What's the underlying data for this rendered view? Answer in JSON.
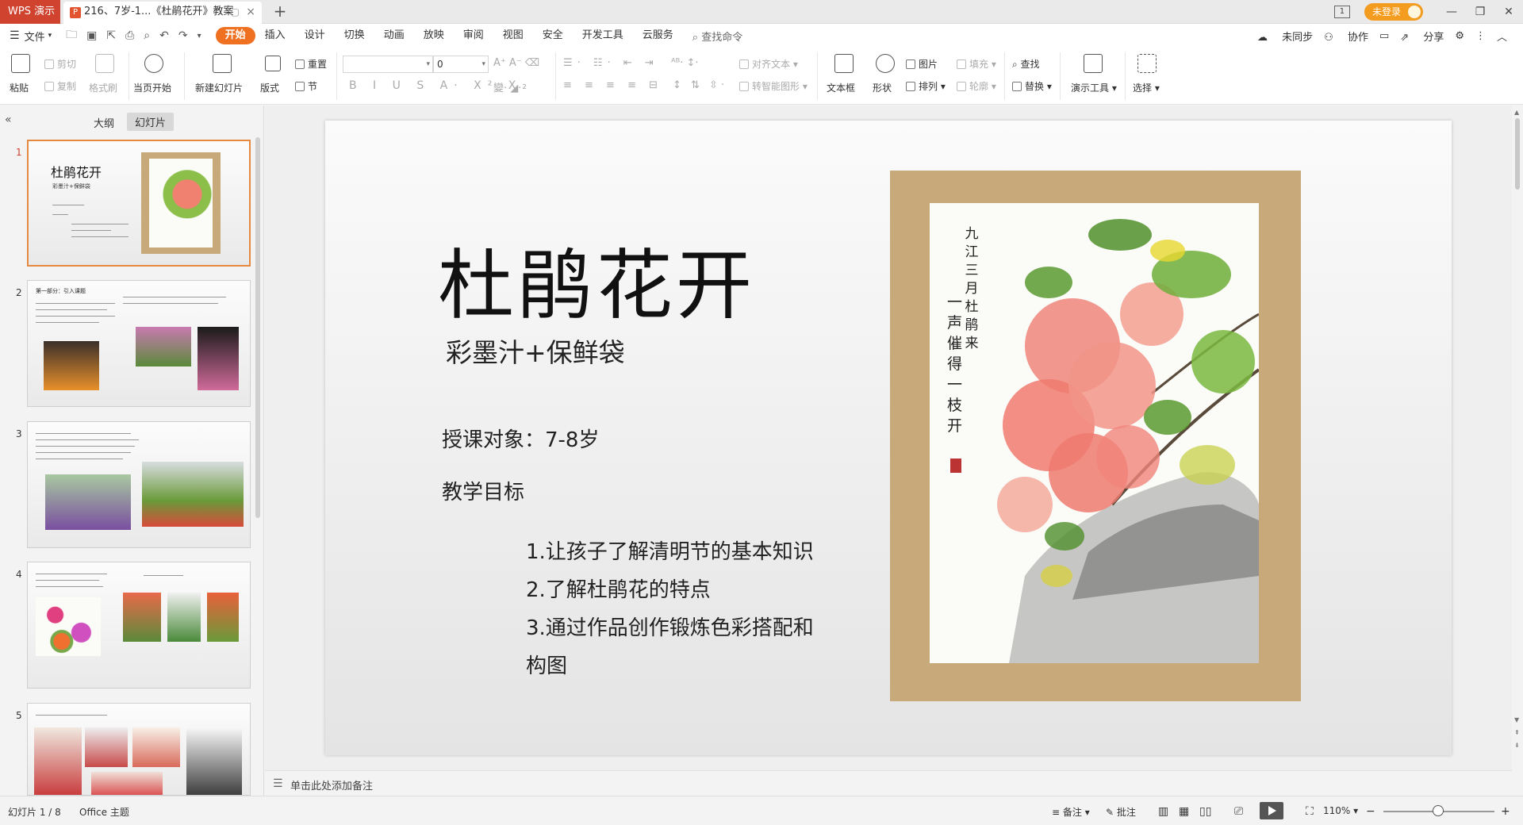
{
  "titlebar": {
    "app_tab": "WPS 演示",
    "doc_tab": "216、7岁-1...《杜鹃花开》教案",
    "login": "未登录"
  },
  "menubar": {
    "file": "文件",
    "tabs": [
      "开始",
      "插入",
      "设计",
      "切换",
      "动画",
      "放映",
      "审阅",
      "视图",
      "安全",
      "开发工具",
      "云服务"
    ],
    "search_cmd": "查找命令",
    "right": {
      "sync": "未同步",
      "collab": "协作",
      "share": "分享"
    }
  },
  "ribbon": {
    "paste": "粘贴",
    "cut": "剪切",
    "copy": "复制",
    "format_painter": "格式刷",
    "start_from_current": "当页开始",
    "new_slide": "新建幻灯片",
    "layout": "版式",
    "reset": "重置",
    "section": "节",
    "font_size_value": "0",
    "align_text": "对齐文本",
    "convert_smartart": "转智能图形",
    "textbox": "文本框",
    "shape": "形状",
    "picture": "图片",
    "arrange": "排列",
    "fill": "填充",
    "outline": "轮廓",
    "find": "查找",
    "replace": "替换",
    "presenter_tools": "演示工具",
    "select": "选择"
  },
  "left_panel": {
    "tab_outline": "大纲",
    "tab_slides": "幻灯片",
    "thumbnails": [
      {
        "num": "1",
        "title": "杜鹃花开",
        "sub": "彩墨汁+保鲜袋"
      },
      {
        "num": "2",
        "title": "第一部分：引入课题"
      },
      {
        "num": "3"
      },
      {
        "num": "4"
      },
      {
        "num": "5"
      }
    ]
  },
  "slide": {
    "title": "杜鹃花开",
    "subtitle": "彩墨汁+保鲜袋",
    "audience": "授课对象：7-8岁",
    "goals_heading": "教学目标",
    "goals": [
      "1.让孩子了解清明节的基本知识",
      "2.了解杜鹃花的特点",
      "3.通过作品创作锻炼色彩搭配和构图"
    ],
    "calligraphy": {
      "col1": "九江三月杜鹃来",
      "col2": "一声催得一枝开"
    }
  },
  "notes": {
    "placeholder": "单击此处添加备注"
  },
  "status": {
    "slide_count": "幻灯片 1 / 8",
    "theme": "Office 主题",
    "notes_btn": "备注",
    "comments_btn": "批注",
    "zoom": "110%"
  },
  "colors": {
    "wps_red": "#d0432f",
    "active_tab_orange": "#ef7021",
    "login_orange": "#f39c1f",
    "thumb_selected_border": "#e4893f"
  }
}
